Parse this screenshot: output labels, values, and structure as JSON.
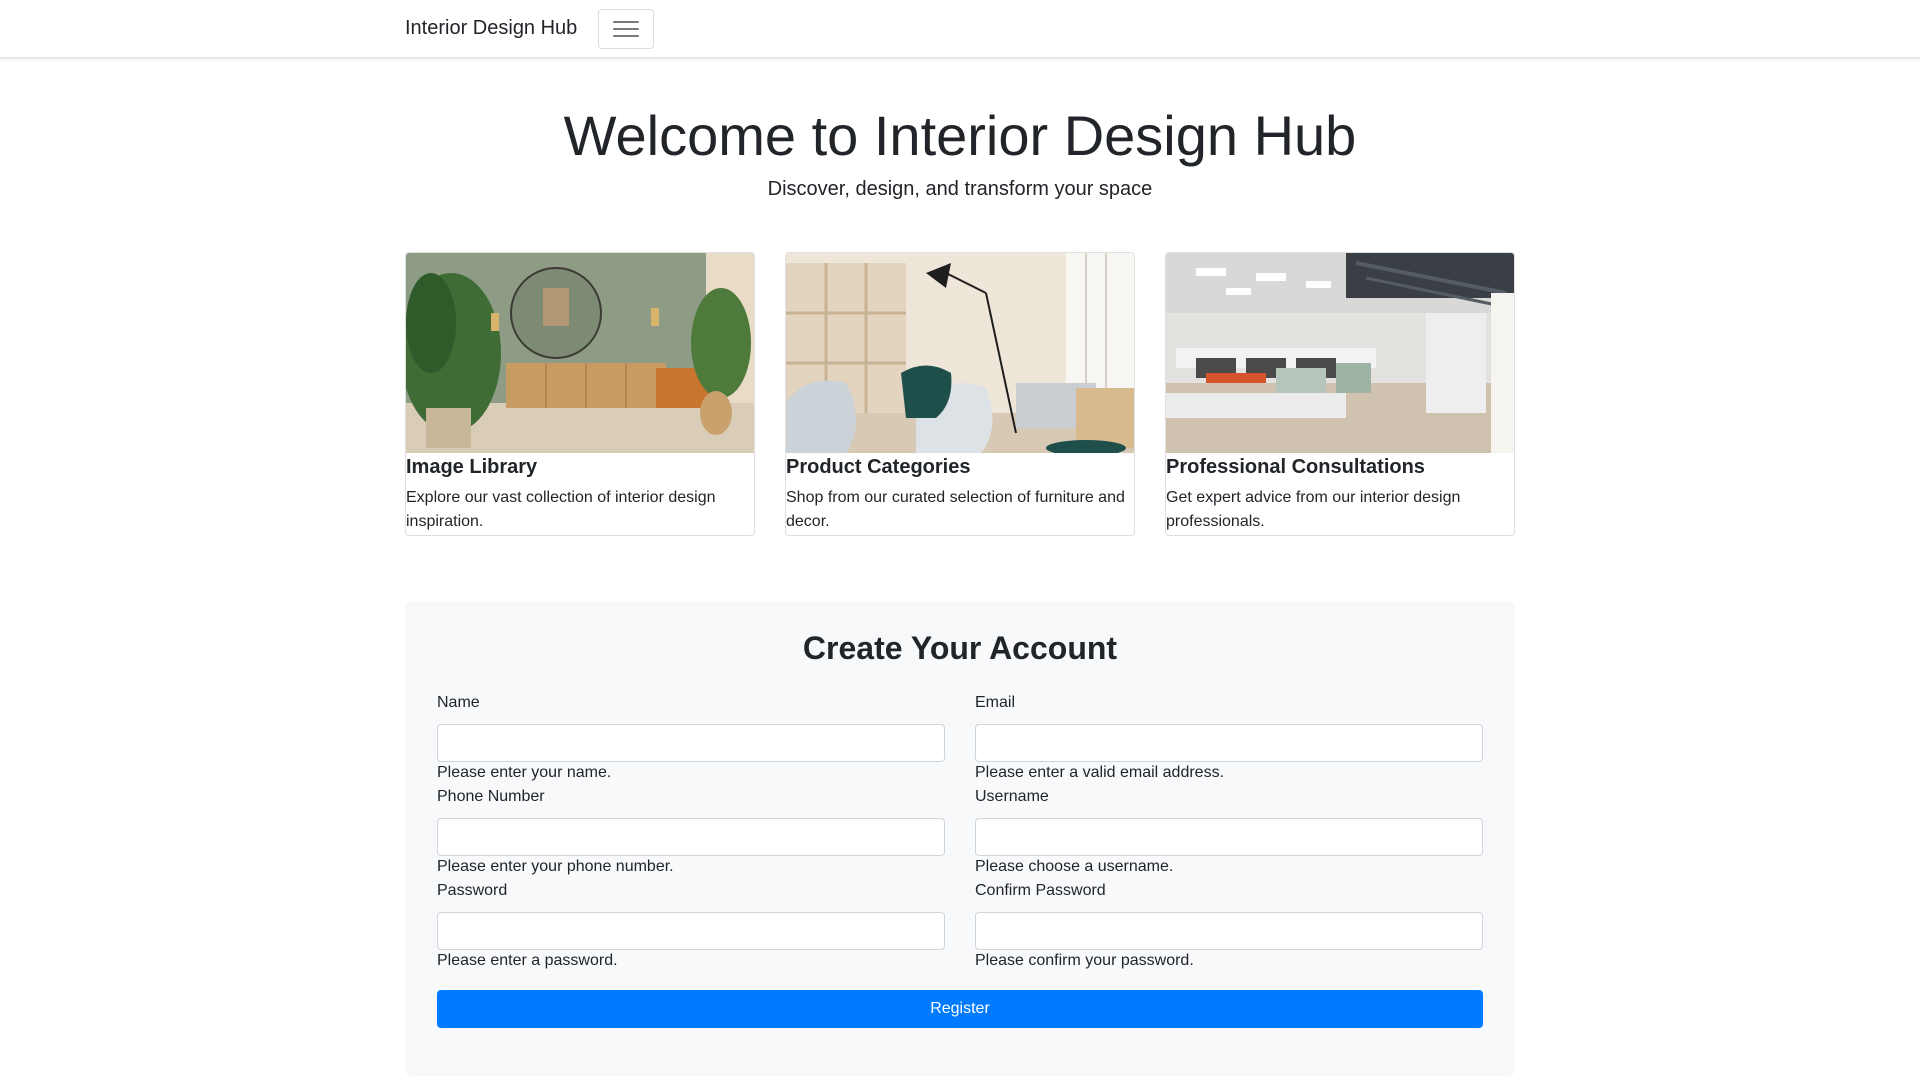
{
  "navbar": {
    "brand": "Interior Design Hub",
    "toggler_icon": "hamburger-menu-icon"
  },
  "hero": {
    "title": "Welcome to Interior Design Hub",
    "subtitle": "Discover, design, and transform your space"
  },
  "cards": [
    {
      "title": "Image Library",
      "text": "Explore our vast collection of interior design inspiration."
    },
    {
      "title": "Product Categories",
      "text": "Shop from our curated selection of furniture and decor."
    },
    {
      "title": "Professional Consultations",
      "text": "Get expert advice from our interior design professionals."
    }
  ],
  "form": {
    "title": "Create Your Account",
    "fields": {
      "name": {
        "label": "Name",
        "value": "",
        "help": "Please enter your name."
      },
      "email": {
        "label": "Email",
        "value": "",
        "help": "Please enter a valid email address."
      },
      "phone": {
        "label": "Phone Number",
        "value": "",
        "help": "Please enter your phone number."
      },
      "username": {
        "label": "Username",
        "value": "",
        "help": "Please choose a username."
      },
      "password": {
        "label": "Password",
        "value": "",
        "help": "Please enter a password."
      },
      "confirm_password": {
        "label": "Confirm Password",
        "value": "",
        "help": "Please confirm your password."
      }
    },
    "submit_label": "Register"
  },
  "colors": {
    "primary": "#007bff",
    "panel_bg": "#f8f9fa",
    "text": "#212529"
  }
}
